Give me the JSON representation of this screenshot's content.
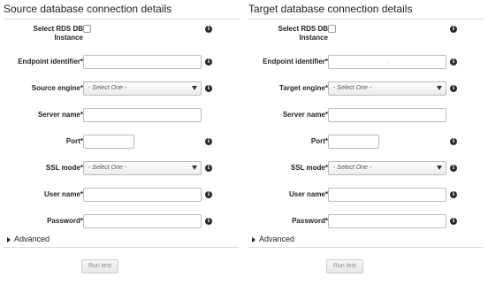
{
  "source": {
    "title": "Source database connection details",
    "rds_label": "Select RDS DB Instance",
    "endpoint_label": "Endpoint identifier*",
    "endpoint_value": "",
    "engine_label": "Source engine*",
    "engine_select": "- Select One -",
    "server_label": "Server name*",
    "port_label": "Port*",
    "ssl_label": "SSL mode*",
    "ssl_select": "- Select One -",
    "user_label": "User name*",
    "password_label": "Password*",
    "advanced_label": "Advanced",
    "run_test_label": "Run test"
  },
  "target": {
    "title": "Target database connection details",
    "rds_label": "Select RDS DB Instance",
    "endpoint_label": "Endpoint identifier*",
    "endpoint_value": ".",
    "engine_label": "Target engine*",
    "engine_select": "- Select One -",
    "server_label": "Server name*",
    "port_label": "Port*",
    "ssl_label": "SSL mode*",
    "ssl_select": "- Select One -",
    "user_label": "User name*",
    "password_label": "Password*",
    "advanced_label": "Advanced",
    "run_test_label": "Run test"
  },
  "icons": {
    "info": "info-icon",
    "expand": "triangle-right-icon",
    "dropdown": "chevron-down-icon"
  }
}
